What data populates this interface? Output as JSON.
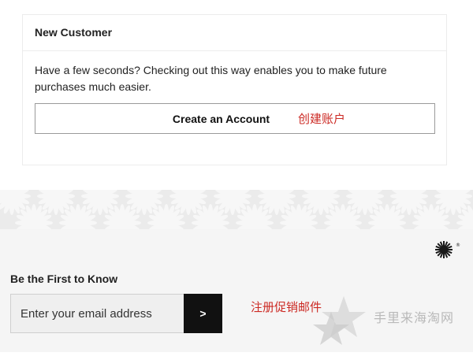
{
  "new_customer": {
    "heading": "New Customer",
    "description": "Have a few seconds? Checking out this way enables you to make future purchases much easier.",
    "create_account_label": "Create an Account",
    "annotation": "创建账户"
  },
  "newsletter": {
    "heading": "Be the First to Know",
    "email_placeholder": "Enter your email address",
    "submit_label": ">",
    "annotation": "注册促销邮件"
  },
  "brand": {
    "icon": "sunburst-logo-icon",
    "registered_mark": "®"
  },
  "watermark": {
    "text": "手里来海淘网",
    "icon": "star-icon"
  },
  "colors": {
    "annotation_red": "#cc2a24",
    "button_dark": "#111111",
    "band_bg": "#ebebeb",
    "footer_bg": "#f5f5f5"
  }
}
